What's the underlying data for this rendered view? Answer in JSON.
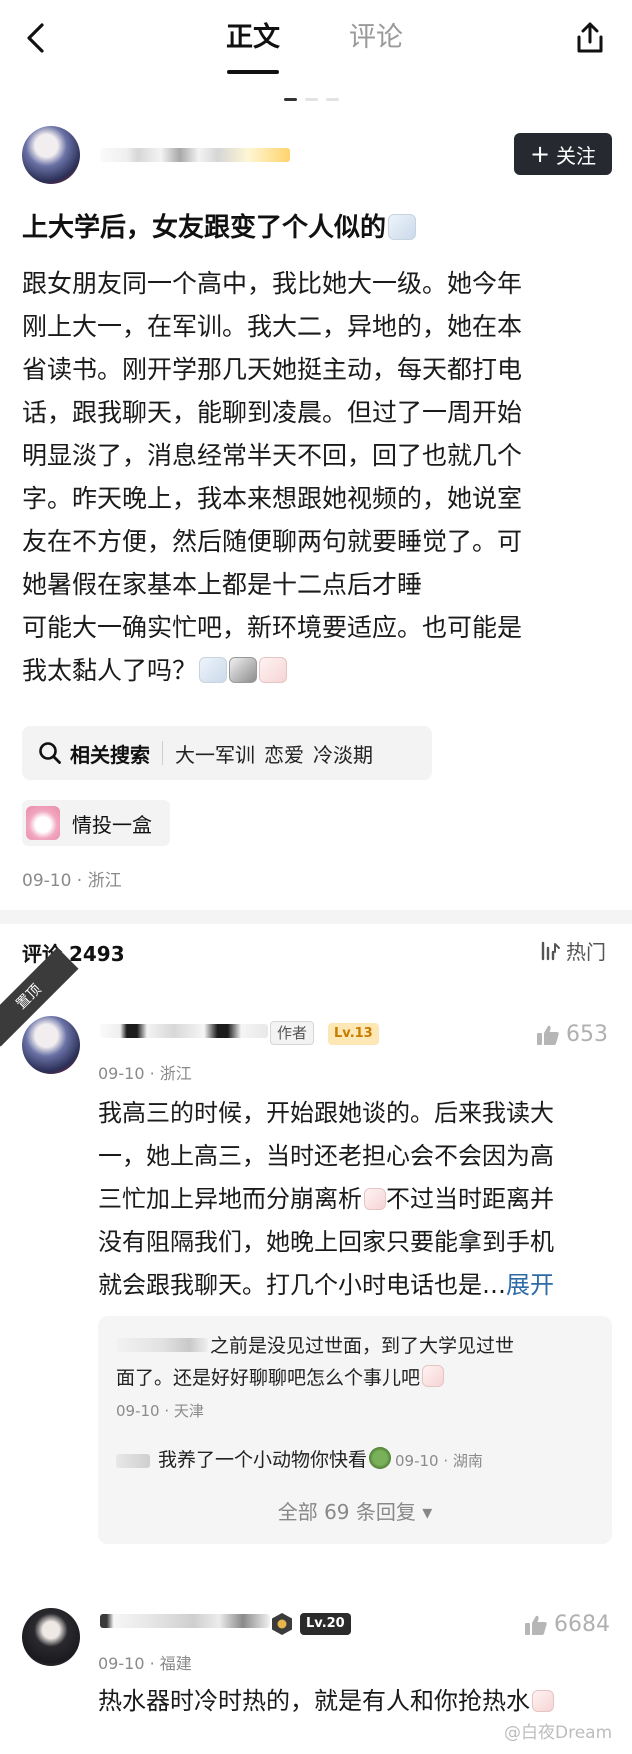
{
  "tabs": {
    "article": "正文",
    "comments": "评论"
  },
  "post": {
    "follow_label": "关注",
    "title": "上大学后，女友跟变了个人似的",
    "body_lines": [
      "跟女朋友同一个高中，我比她大一级。她今年",
      "刚上大一，在军训。我大二，异地的，她在本",
      "省读书。刚开学那几天她挺主动，每天都打电",
      "话，跟我聊天，能聊到凌晨。但过了一周开始",
      "明显淡了，消息经常半天不回，回了也就几个",
      "字。昨天晚上，我本来想跟她视频的，她说室",
      "友在不方便，然后随便聊两句就要睡觉了。可",
      "她暑假在家基本上都是十二点后才睡",
      "可能大一确实忙吧，新环境要适应。也可能是",
      "我太黏人了吗？"
    ],
    "related_search": {
      "label": "相关搜索",
      "keywords": [
        "大一军训",
        "恋爱",
        "冷淡期"
      ]
    },
    "topic": "情投一盒",
    "meta": "09-10 · 浙江"
  },
  "comments_header": {
    "count_label": "评论 2493",
    "sort_label": "热门"
  },
  "pinned_label": "置顶",
  "comments": [
    {
      "role_badge": "作者",
      "level": "Lv.13",
      "likes": "653",
      "meta": "09-10 · 浙江",
      "lines": [
        "我高三的时候，开始跟她谈的。后来我读大",
        "一，她上高三，当时还老担心会不会因为高",
        "三忙加上异地而分崩离析",
        "不过当时距离并",
        "没有阻隔我们，她晚上回家只要能拿到手机",
        "就会跟我聊天。打几个小时电话也是…"
      ],
      "expand": "展开",
      "replies": [
        {
          "text_lines": [
            "之前是没见过世面，到了大学见过世",
            "面了。还是好好聊聊吧怎么个事儿吧"
          ],
          "meta": "09-10 · 天津"
        },
        {
          "text": "我养了一个小动物你快看",
          "meta": "09-10 · 湖南"
        }
      ],
      "more_replies": "全部 69 条回复 ▾"
    },
    {
      "level": "Lv.20",
      "likes": "6684",
      "meta": "09-10 · 福建",
      "text": "热水器时冷时热的，就是有人和你抢热水"
    }
  ],
  "watermark": "@白夜Dream",
  "icons": [
    "back-arrow-icon",
    "share-icon",
    "plus-icon",
    "search-icon",
    "sort-icon",
    "thumb-up-icon",
    "chevron-down-icon"
  ],
  "colors": {
    "follow_bg": "#262a30",
    "expand_link": "#2d6aa6",
    "lv13_bg": "#fde7b5",
    "muted": "#8a8a8a"
  }
}
